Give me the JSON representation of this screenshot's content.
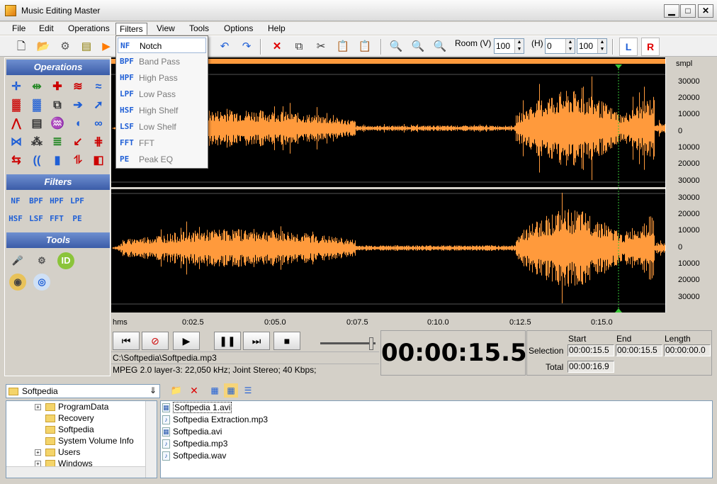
{
  "window": {
    "title": "Music Editing Master",
    "minimize": "▁",
    "maximize": "□",
    "close": "✕"
  },
  "menu": [
    "File",
    "Edit",
    "Operations",
    "Filters",
    "View",
    "Tools",
    "Options",
    "Help"
  ],
  "toolbar": {
    "zoom_label": "Room (V)",
    "zoom_v_value": "100",
    "h_label": "(H)",
    "h_value": "0",
    "zoom_h_value": "100",
    "left_channel": "L",
    "right_channel": "R"
  },
  "filters_menu": [
    {
      "icon": "NF",
      "label": "Notch"
    },
    {
      "icon": "BPF",
      "label": "Band Pass"
    },
    {
      "icon": "HPF",
      "label": "High Pass"
    },
    {
      "icon": "LPF",
      "label": "Low Pass"
    },
    {
      "icon": "HSF",
      "label": "High Shelf"
    },
    {
      "icon": "LSF",
      "label": "Low Shelf"
    },
    {
      "icon": "FFT",
      "label": "FFT"
    },
    {
      "icon": "PE",
      "label": "Peak EQ"
    }
  ],
  "left_panel": {
    "operations_title": "Operations",
    "filters_title": "Filters",
    "tools_title": "Tools",
    "filter_icons": [
      "NF",
      "BPF",
      "HPF",
      "LPF",
      "HSF",
      "LSF",
      "FFT",
      "PE"
    ]
  },
  "waveform": {
    "unit": "smpl",
    "y_ticks_top": [
      "30000",
      "20000",
      "10000",
      "0",
      "10000",
      "20000",
      "30000"
    ],
    "y_ticks_bottom": [
      "30000",
      "20000",
      "10000",
      "0",
      "10000",
      "20000",
      "30000"
    ],
    "time_unit": "hms",
    "time_ticks": [
      "0:02.5",
      "0:05.0",
      "0:07.5",
      "0:10.0",
      "0:12.5",
      "0:15.0"
    ],
    "wave_color": "#ff9a3c",
    "cursor_color": "#39c639"
  },
  "player": {
    "file_path": "C:\\Softpedia\\Softpedia.mp3",
    "file_info": "MPEG 2.0 layer-3: 22,050 kHz; Joint Stereo; 40 Kbps;",
    "time": "00:00:15.5",
    "volume_fraction": 0.92
  },
  "selection": {
    "start_label": "Start",
    "end_label": "End",
    "length_label": "Length",
    "selection_label": "Selection",
    "total_label": "Total",
    "start": "00:00:15.5",
    "end": "00:00:15.5",
    "length": "00:00:00.0",
    "total": "00:00:16.9"
  },
  "browser": {
    "folder": "Softpedia",
    "tree": [
      {
        "label": "ProgramData",
        "expandable": true
      },
      {
        "label": "Recovery",
        "expandable": false
      },
      {
        "label": "Softpedia",
        "expandable": false
      },
      {
        "label": "System Volume Info",
        "expandable": false
      },
      {
        "label": "Users",
        "expandable": true
      },
      {
        "label": "Windows",
        "expandable": true
      }
    ],
    "files": [
      {
        "icon": "video-file-icon",
        "name": "Softpedia 1.avi"
      },
      {
        "icon": "audio-file-icon",
        "name": "Softpedia Extraction.mp3"
      },
      {
        "icon": "video-file-icon",
        "name": "Softpedia.avi"
      },
      {
        "icon": "audio-file-icon",
        "name": "Softpedia.mp3"
      },
      {
        "icon": "audio-file-icon",
        "name": "Softpedia.wav"
      }
    ]
  }
}
